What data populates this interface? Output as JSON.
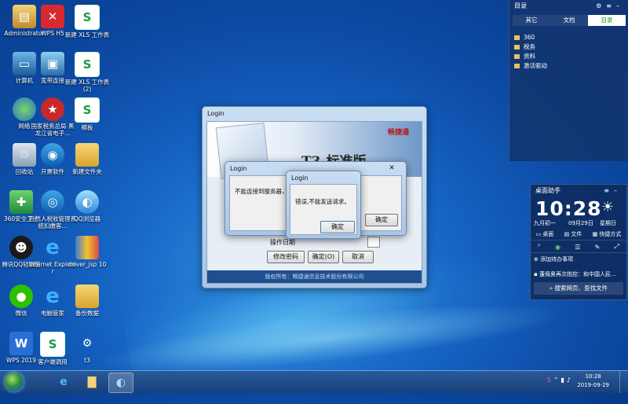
{
  "desktop_icons": [
    {
      "label": "Administrator",
      "icon": "user-folder-icon"
    },
    {
      "label": "WPS H5",
      "icon": "wps-icon"
    },
    {
      "label": "新建 XLS 工作表",
      "icon": "spreadsheet-icon"
    },
    {
      "label": "计算机",
      "icon": "computer-icon"
    },
    {
      "label": "宽带连接",
      "icon": "broadband-icon"
    },
    {
      "label": "新建 XLS 工作表 (2)",
      "icon": "spreadsheet-icon"
    },
    {
      "label": "网络",
      "icon": "network-icon"
    },
    {
      "label": "国家税务总局 黑龙江省电子...",
      "icon": "tax-bureau-icon"
    },
    {
      "label": "模板",
      "icon": "template-icon"
    },
    {
      "label": "回收站",
      "icon": "recycle-bin-icon"
    },
    {
      "label": "开票软件",
      "icon": "invoice-software-icon"
    },
    {
      "label": "新建文件夹",
      "icon": "folder-icon"
    },
    {
      "label": "360安全卫士",
      "icon": "360-icon"
    },
    {
      "label": "自然人税收管理系统扣缴客...",
      "icon": "tax-system-icon"
    },
    {
      "label": "QQ浏览器",
      "icon": "qq-browser-icon"
    },
    {
      "label": "腾讯QQ轻聊版",
      "icon": "qq-icon"
    },
    {
      "label": "Internet Explorer",
      "icon": "ie-icon"
    },
    {
      "label": "driver_jsp 10",
      "icon": "archive-icon"
    },
    {
      "label": "微信",
      "icon": "wechat-icon"
    },
    {
      "label": "电脑管家",
      "icon": "ie-icon"
    },
    {
      "label": "备份数据",
      "icon": "folder-icon"
    },
    {
      "label": "WPS 2019",
      "icon": "wps2019-icon"
    },
    {
      "label": "客户端调用",
      "icon": "document-icon"
    },
    {
      "label": "t3",
      "icon": "t3-icon"
    }
  ],
  "t3_window": {
    "title": "Login",
    "brand": "畅捷通",
    "product": "T3-标准版",
    "date_label": "操作日期",
    "change_password_button": "修改密码",
    "ok_button": "确定(O)",
    "cancel_button": "取消",
    "footer": "版权所有：畅捷通信息技术股份有限公司"
  },
  "login_dialog": {
    "title": "Login",
    "message": "不能连接到服务器，可能服务器没有启动。",
    "ok_button": "确定",
    "close": "✕"
  },
  "error_dialog": {
    "title": "Login",
    "message": "错误,不能发送请求。",
    "ok_button": "确定"
  },
  "directory_panel": {
    "title": "目录",
    "tabs": [
      "其它",
      "文档",
      "目录"
    ],
    "active_tab": "目录",
    "items": [
      "360",
      "税务",
      "资料",
      "激活驱动"
    ]
  },
  "desktop_assistant": {
    "title": "桌面助手",
    "time": "10:28",
    "lunar": "九月初一",
    "date": "09月29日",
    "weather": "星期日",
    "links": [
      "桌面",
      "文件",
      "快捷方式"
    ],
    "add_todo": "添加待办事项",
    "news": "蓬佩奥再次指控：和中国人民...",
    "search": "搜索网页、查找文件"
  },
  "taskbar": {
    "time": "10:28",
    "date": "2019-09-29"
  },
  "colors": {
    "desktop_blue": "#1665c4",
    "taskbar": "#1f4c8c",
    "active_tab": "#2a8f2a"
  }
}
